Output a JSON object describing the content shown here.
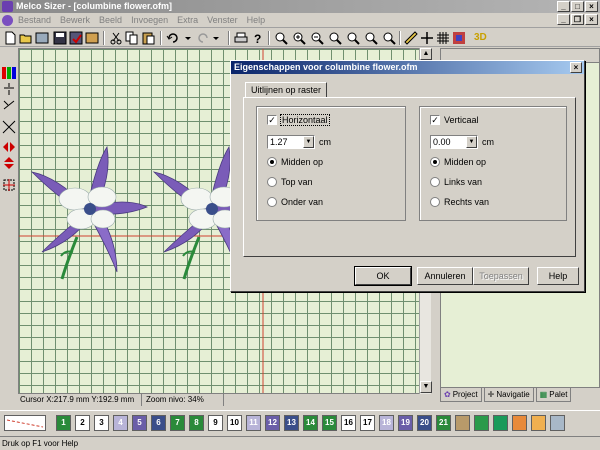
{
  "window": {
    "title": "Melco Sizer - [columbine flower.ofm]"
  },
  "menu": [
    "Bestand",
    "Bewerk",
    "Beeld",
    "Invoegen",
    "Extra",
    "Venster",
    "Help"
  ],
  "status": {
    "cursor": "Cursor X:217.9 mm Y:192.9 mm",
    "zoom": "Zoom nivo: 34%",
    "help": "Druk op F1 voor Help"
  },
  "toolbar_text": {
    "zoom_3d": "3D"
  },
  "right_panel": {
    "tabs": [
      "Project",
      "Navigatie",
      "Palet"
    ]
  },
  "dialog": {
    "title": "Eigenschappen voor columbine flower.ofm",
    "close": "×",
    "tab": "Uitlijnen op raster",
    "horizontal": {
      "label": "Horizontaal",
      "checked": true,
      "value": "1.27",
      "unit": "cm",
      "options": [
        "Midden op",
        "Top van",
        "Onder van"
      ],
      "selected": "Midden op"
    },
    "vertical": {
      "label": "Verticaal",
      "checked": true,
      "value": "0.00",
      "unit": "cm",
      "options": [
        "Midden op",
        "Links van",
        "Rechts van"
      ],
      "selected": "Midden op"
    },
    "buttons": {
      "ok": "OK",
      "cancel": "Annuleren",
      "apply": "Toepassen",
      "help": "Help"
    }
  },
  "palette": [
    {
      "n": "1",
      "c": "#2a8a3a",
      "t": "#fff"
    },
    {
      "n": "2",
      "c": "#ffffff",
      "t": "#000"
    },
    {
      "n": "3",
      "c": "#ffffff",
      "t": "#000"
    },
    {
      "n": "4",
      "c": "#b8b4d8",
      "t": "#fff"
    },
    {
      "n": "5",
      "c": "#6a5ea8",
      "t": "#fff"
    },
    {
      "n": "6",
      "c": "#3a4e8a",
      "t": "#fff"
    },
    {
      "n": "7",
      "c": "#2a8a3a",
      "t": "#fff"
    },
    {
      "n": "8",
      "c": "#2a8a3a",
      "t": "#fff"
    },
    {
      "n": "9",
      "c": "#ffffff",
      "t": "#000"
    },
    {
      "n": "10",
      "c": "#ffffff",
      "t": "#000"
    },
    {
      "n": "11",
      "c": "#b8b4d8",
      "t": "#fff"
    },
    {
      "n": "12",
      "c": "#6a5ea8",
      "t": "#fff"
    },
    {
      "n": "13",
      "c": "#3a4e8a",
      "t": "#fff"
    },
    {
      "n": "14",
      "c": "#2a8a3a",
      "t": "#fff"
    },
    {
      "n": "15",
      "c": "#2a8a3a",
      "t": "#fff"
    },
    {
      "n": "16",
      "c": "#ffffff",
      "t": "#000"
    },
    {
      "n": "17",
      "c": "#ffffff",
      "t": "#000"
    },
    {
      "n": "18",
      "c": "#b8b4d8",
      "t": "#fff"
    },
    {
      "n": "19",
      "c": "#6a5ea8",
      "t": "#fff"
    },
    {
      "n": "20",
      "c": "#3a4e8a",
      "t": "#fff"
    },
    {
      "n": "21",
      "c": "#2a8a3a",
      "t": "#fff"
    },
    {
      "n": "",
      "c": "#b89a6a",
      "t": "#000"
    },
    {
      "n": "",
      "c": "#2a9a4a",
      "t": "#000"
    },
    {
      "n": "",
      "c": "#1a9a5a",
      "t": "#000"
    },
    {
      "n": "",
      "c": "#e88a3a",
      "t": "#000"
    },
    {
      "n": "",
      "c": "#f0b050",
      "t": "#000"
    },
    {
      "n": "",
      "c": "#a8b8c8",
      "t": "#000"
    }
  ]
}
